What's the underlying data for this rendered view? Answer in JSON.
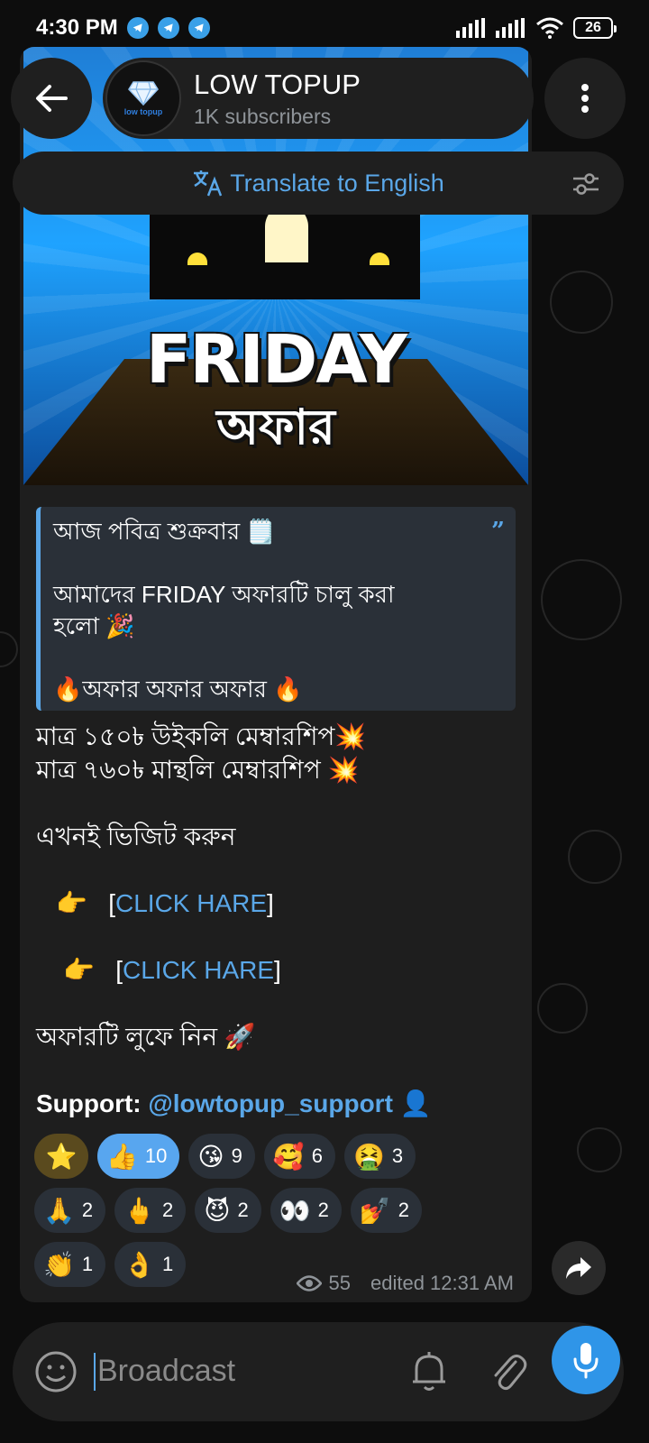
{
  "status_bar": {
    "time": "4:30 PM",
    "battery": "26",
    "notification_icons": [
      "telegram-icon",
      "telegram-icon",
      "telegram-icon"
    ]
  },
  "header": {
    "title": "LOW TOPUP",
    "subtitle": "1K subscribers",
    "avatar_text": "low topup"
  },
  "translate_bar": {
    "label": "Translate to English"
  },
  "post": {
    "banner": {
      "title": "FRIDAY",
      "subtitle": "অফার"
    },
    "quote_lines": [
      "আজ পবিত্র শুক্রবার 🗒️",
      "আমাদের FRIDAY অফারটি চালু করা",
      "হলো 🎉",
      "🔥অফার অফার অফার 🔥"
    ],
    "lines": {
      "weekly": "মাত্র ১৫০৳ উইকলি মেম্বারশিপ💥",
      "monthly": "মাত্র ৭৬০৳ মান্থলি মেম্বারশিপ 💥",
      "visit": "এখনই ভিজিট করুন",
      "pointer": "👉",
      "link1": "CLICK HARE",
      "link2": "CLICK HARE",
      "grab": "অফারটি  লুফে  নিন  🚀",
      "support_label": "Support: ",
      "support_handle": "@lowtopup_support",
      "support_emoji": "👤"
    },
    "reactions": [
      {
        "emoji": "⭐",
        "count": ""
      },
      {
        "emoji": "👍",
        "count": "10"
      },
      {
        "emoji": "😘",
        "count": "9"
      },
      {
        "emoji": "🥰",
        "count": "6"
      },
      {
        "emoji": "🤮",
        "count": "3"
      },
      {
        "emoji": "🙏",
        "count": "2"
      },
      {
        "emoji": "🖕",
        "count": "2"
      },
      {
        "emoji": "😈",
        "count": "2"
      },
      {
        "emoji": "👀",
        "count": "2"
      },
      {
        "emoji": "💅",
        "count": "2"
      },
      {
        "emoji": "👏",
        "count": "1"
      },
      {
        "emoji": "👌",
        "count": "1"
      }
    ],
    "views": "55",
    "edited": "edited 12:31 AM"
  },
  "composer": {
    "placeholder": "Broadcast"
  },
  "colors": {
    "accent": "#5aa7e8",
    "active_reaction": "#58a6ef",
    "mic": "#2f95e8"
  }
}
